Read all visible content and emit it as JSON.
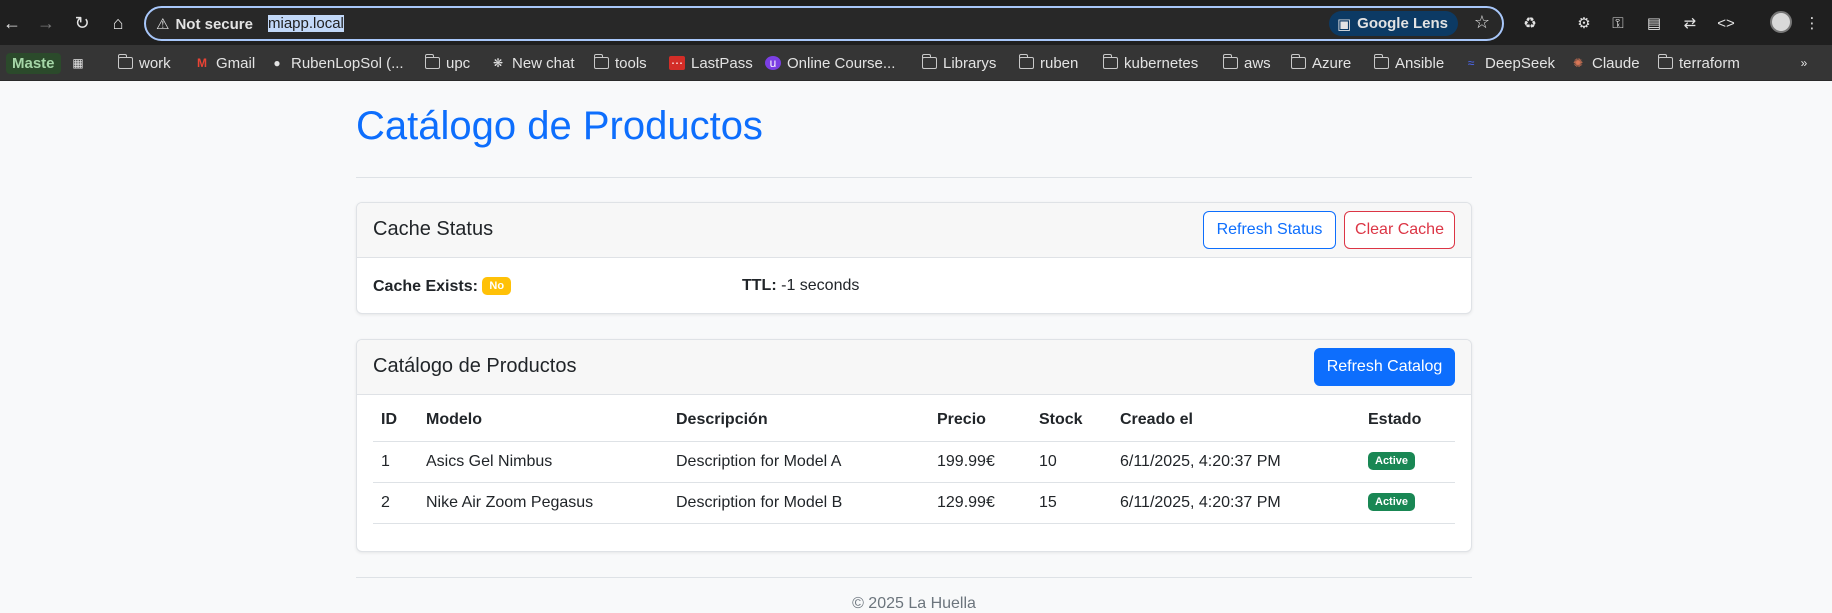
{
  "browser": {
    "security_label": "Not secure",
    "url": "miapp.local",
    "lens_label": "Google Lens",
    "bookmarks": [
      {
        "label": "Maste",
        "icon": "maste-badge"
      },
      {
        "label": "work",
        "icon": "folder-icon"
      },
      {
        "label": "Gmail",
        "icon": "gmail-icon"
      },
      {
        "label": "RubenLopSol (...",
        "icon": "github-icon"
      },
      {
        "label": "upc",
        "icon": "folder-icon"
      },
      {
        "label": "New chat",
        "icon": "chatgpt-icon"
      },
      {
        "label": "tools",
        "icon": "folder-icon"
      },
      {
        "label": "LastPass",
        "icon": "lastpass-icon"
      },
      {
        "label": "Online Course...",
        "icon": "course-icon"
      },
      {
        "label": "Librarys",
        "icon": "folder-icon"
      },
      {
        "label": "ruben",
        "icon": "folder-icon"
      },
      {
        "label": "kubernetes",
        "icon": "folder-icon"
      },
      {
        "label": "aws",
        "icon": "folder-icon"
      },
      {
        "label": "Azure",
        "icon": "folder-icon"
      },
      {
        "label": "Ansible",
        "icon": "folder-icon"
      },
      {
        "label": "DeepSeek",
        "icon": "deepseek-icon"
      },
      {
        "label": "Claude",
        "icon": "claude-icon"
      },
      {
        "label": "terraform",
        "icon": "folder-icon"
      }
    ]
  },
  "page": {
    "title": "Catálogo de Productos"
  },
  "cache": {
    "header": "Cache Status",
    "refresh_label": "Refresh Status",
    "clear_label": "Clear Cache",
    "exists_label": "Cache Exists:",
    "exists_value": "No",
    "ttl_label": "TTL:",
    "ttl_value": "-1 seconds"
  },
  "catalog": {
    "header": "Catálogo de Productos",
    "refresh_label": "Refresh Catalog",
    "columns": [
      "ID",
      "Modelo",
      "Descripción",
      "Precio",
      "Stock",
      "Creado el",
      "Estado"
    ],
    "rows": [
      {
        "id": "1",
        "modelo": "Asics Gel Nimbus",
        "descripcion": "Description for Model A",
        "precio": "199.99€",
        "stock": "10",
        "creado": "6/11/2025, 4:20:37 PM",
        "estado": "Active"
      },
      {
        "id": "2",
        "modelo": "Nike Air Zoom Pegasus",
        "descripcion": "Description for Model B",
        "precio": "129.99€",
        "stock": "15",
        "creado": "6/11/2025, 4:20:37 PM",
        "estado": "Active"
      }
    ]
  },
  "footer": {
    "text": "© 2025 La Huella"
  },
  "colors": {
    "primary": "#0d6efd",
    "danger": "#dc3545",
    "warning": "#ffc107",
    "success": "#198754"
  }
}
